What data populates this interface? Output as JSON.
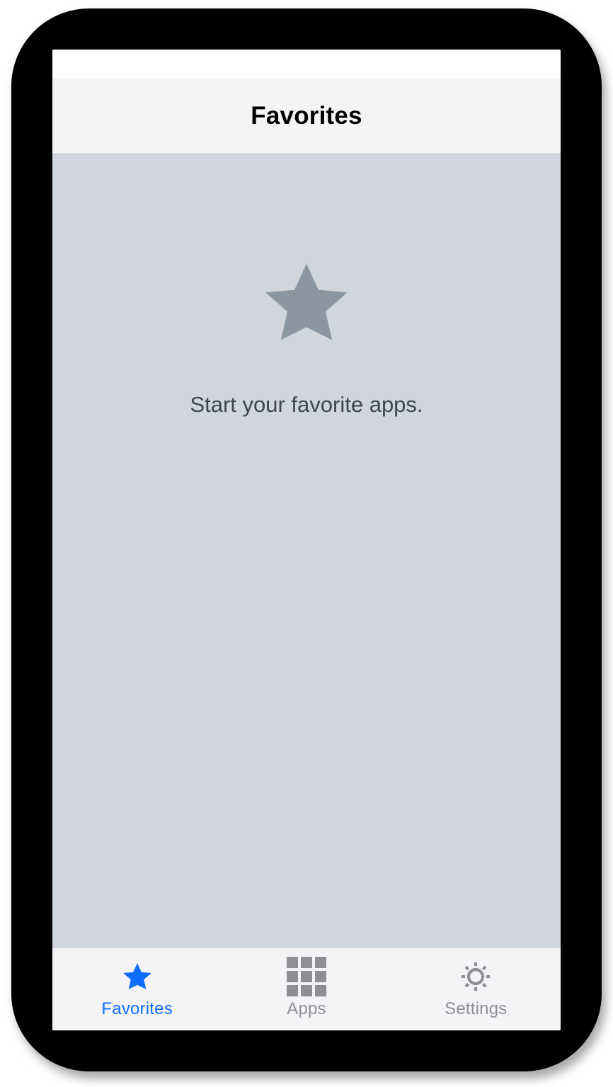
{
  "header": {
    "title": "Favorites"
  },
  "empty": {
    "message": "Start your favorite apps."
  },
  "tabs": [
    {
      "label": "Favorites",
      "icon": "star-icon",
      "active": true
    },
    {
      "label": "Apps",
      "icon": "grid-icon",
      "active": false
    },
    {
      "label": "Settings",
      "icon": "gear-icon",
      "active": false
    }
  ],
  "colors": {
    "accent": "#0d6efd",
    "inactive": "#8e8e93",
    "content_bg": "#d0d5de",
    "bar_bg": "#f4f4f7"
  }
}
